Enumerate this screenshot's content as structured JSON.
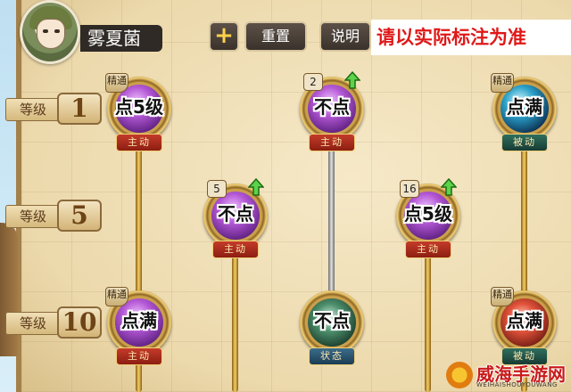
{
  "player": {
    "name": "雾夏菌"
  },
  "toolbar": {
    "add_label": "+",
    "reset_label": "重置",
    "help_label": "说明"
  },
  "notice": "请以实际标注为准",
  "level_label": "等级",
  "levels": [
    "1",
    "5",
    "10"
  ],
  "skills": [
    {
      "id": "s1",
      "type": "主动",
      "rank_badge": "精通",
      "note": "点5级",
      "gem": "purple",
      "icon": "crystal-icon"
    },
    {
      "id": "s2",
      "type": "主动",
      "count": "2",
      "upgrade": true,
      "note": "不点",
      "gem": "purple",
      "icon": "crystal-icon"
    },
    {
      "id": "s3",
      "type": "被动",
      "rank_badge": "精通",
      "note": "点满",
      "gem": "cyan",
      "icon": "wave-icon"
    },
    {
      "id": "s4",
      "type": "主动",
      "count": "5",
      "upgrade": true,
      "note": "不点",
      "gem": "purple",
      "icon": "spike-icon"
    },
    {
      "id": "s5",
      "type": "主动",
      "count": "16",
      "upgrade": true,
      "note": "点5级",
      "gem": "purple",
      "icon": "crystal-icon"
    },
    {
      "id": "s6",
      "type": "主动",
      "rank_badge": "精通",
      "note": "点满",
      "gem": "purple",
      "icon": "plus-crystal-icon"
    },
    {
      "id": "s7",
      "type": "状态",
      "note": "不点",
      "gem": "green",
      "icon": "lock-icon"
    },
    {
      "id": "s8",
      "type": "被动",
      "rank_badge": "精通",
      "note": "点满",
      "gem": "red",
      "icon": "fire-icon"
    }
  ],
  "watermark": {
    "title": "威海手游网",
    "subtitle": "WEIHAISHOUYOUWANG"
  },
  "colors": {
    "notice_text": "#e01818",
    "connector_gold": "#f4cf63",
    "connector_gray": "#c8c8c8"
  }
}
